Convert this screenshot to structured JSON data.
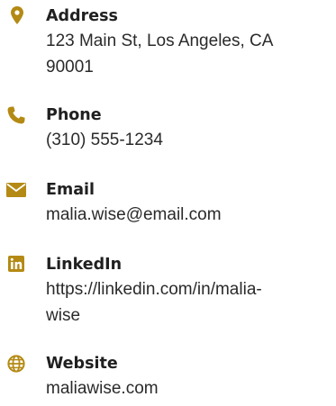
{
  "accent_color": "#b48a14",
  "contacts": [
    {
      "icon": "location-pin-icon",
      "label": "Address",
      "value_lines": [
        "123 Main St, Los Angeles, CA",
        "90001"
      ]
    },
    {
      "icon": "phone-icon",
      "label": "Phone",
      "value_lines": [
        "(310) 555-1234"
      ]
    },
    {
      "icon": "email-envelope-icon",
      "label": "Email",
      "value_lines": [
        "malia.wise@email.com"
      ]
    },
    {
      "icon": "linkedin-icon",
      "label": "LinkedIn",
      "value_lines": [
        "https://linkedin.com/in/malia-",
        "wise"
      ]
    },
    {
      "icon": "globe-icon",
      "label": "Website",
      "value_lines": [
        "maliawise.com"
      ]
    }
  ]
}
